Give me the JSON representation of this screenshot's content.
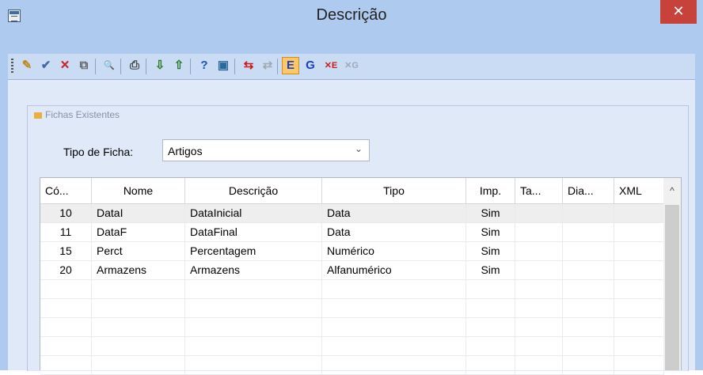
{
  "window": {
    "title": "Descrição",
    "close_label": "✕"
  },
  "toolbar": {
    "buttons": [
      {
        "name": "new-icon",
        "glyph": "✎",
        "color": "#c08a1a"
      },
      {
        "name": "edit-icon",
        "glyph": "✔",
        "color": "#4466aa"
      },
      {
        "name": "delete-icon",
        "glyph": "✕",
        "color": "#d02020"
      },
      {
        "name": "copy-icon",
        "glyph": "⧉",
        "color": "#666666"
      },
      {
        "name": "find-icon",
        "glyph": "🔍",
        "color": "#333333"
      },
      {
        "name": "print-icon",
        "glyph": "⎙",
        "color": "#444444"
      },
      {
        "name": "import-icon",
        "glyph": "⇩",
        "color": "#2a7a2a"
      },
      {
        "name": "export-icon",
        "glyph": "⇧",
        "color": "#2a7a2a"
      },
      {
        "name": "help-icon",
        "glyph": "?",
        "color": "#1b4fc9"
      },
      {
        "name": "exit-icon",
        "glyph": "▣",
        "color": "#2a6a9a"
      },
      {
        "name": "swap-left-icon",
        "glyph": "⇆",
        "color": "#d01818"
      },
      {
        "name": "swap-right-icon",
        "glyph": "⇄",
        "color": "#a0a8b4"
      },
      {
        "name": "mode-e-icon",
        "glyph": "E",
        "color": "#1b3ec9"
      },
      {
        "name": "mode-g-icon",
        "glyph": "G",
        "color": "#1b3ec9"
      },
      {
        "name": "remove-e-icon",
        "glyph": "✕E",
        "color": "#d01818"
      },
      {
        "name": "remove-g-icon",
        "glyph": "✕G",
        "color": "#a0a8b4"
      }
    ]
  },
  "group": {
    "title": "Fichas Existentes"
  },
  "filter": {
    "label": "Tipo de Ficha:",
    "value": "Artigos",
    "arrow": "⌄"
  },
  "table": {
    "columns": [
      "Có...",
      "Nome",
      "Descrição",
      "Tipo",
      "Imp.",
      "Ta...",
      "Dia...",
      "XML"
    ],
    "rows": [
      [
        "10",
        "DataI",
        "DataInicial",
        "Data",
        "Sim",
        "",
        "",
        ""
      ],
      [
        "11",
        "DataF",
        "DataFinal",
        "Data",
        "Sim",
        "",
        "",
        ""
      ],
      [
        "15",
        "Perct",
        "Percentagem",
        "Numérico",
        "Sim",
        "",
        "",
        ""
      ],
      [
        "20",
        "Armazens",
        "Armazens",
        "Alfanumérico",
        "Sim",
        "",
        "",
        ""
      ]
    ],
    "empty_rows": 5,
    "scroll_up": "^"
  }
}
